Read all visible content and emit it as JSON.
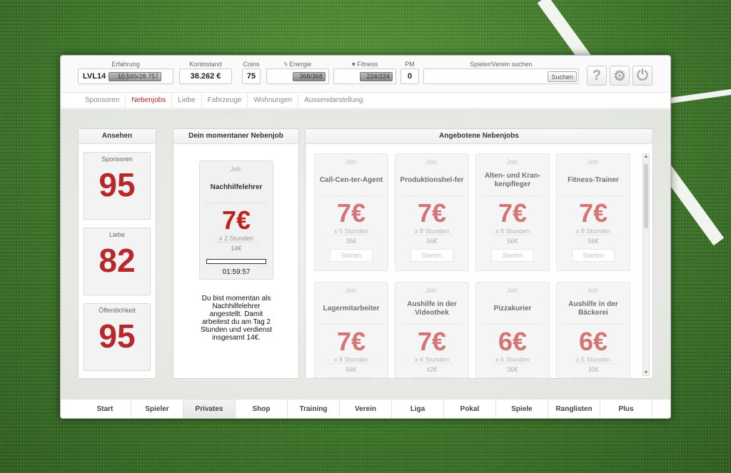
{
  "header": {
    "experience": {
      "label": "Erfahrung",
      "level": "LVL14",
      "value": "10.585/28.757",
      "progress": 0.37
    },
    "balance": {
      "label": "Kontostand",
      "value": "38.262 €"
    },
    "coins": {
      "label": "Coins",
      "value": "75"
    },
    "energy": {
      "label": "Energie",
      "value": "368/368",
      "progress": 1.0,
      "icon": "lightning-icon"
    },
    "fitness": {
      "label": "Fitness",
      "value": "224/224",
      "progress": 1.0,
      "icon": "heart-icon"
    },
    "pm": {
      "label": "PM",
      "value": "0"
    },
    "search": {
      "label": "Spieler/Verein suchen",
      "button": "Suchen",
      "value": ""
    },
    "icons": [
      "help-icon",
      "settings-icon",
      "power-icon"
    ]
  },
  "subtabs": [
    "Sponsoren",
    "Nebenjobs",
    "Liebe",
    "Fahrzeuge",
    "Wohnungen",
    "Aussendarstellung"
  ],
  "active_subtab": "Nebenjobs",
  "ansehen": {
    "title": "Ansehen",
    "items": [
      {
        "label": "Sponsoren",
        "value": "95"
      },
      {
        "label": "Liebe",
        "value": "82"
      },
      {
        "label": "Öffentlichkeit",
        "value": "95"
      }
    ]
  },
  "current_job": {
    "title": "Dein momentaner Nebenjob",
    "job_label": "Job:",
    "name": "Nachhilfelehrer",
    "pay": "7€",
    "duration": "x 2 Stunden",
    "total": "14€",
    "timer": "01:59:57",
    "description": "Du bist momentan als Nachhilfelehrer angestellt. Damit arbeitest du am Tag 2 Stunden und verdienst insgesamt 14€."
  },
  "offered_jobs": {
    "title": "Angebotene Nebenjobs",
    "job_label": "Job:",
    "start_label": "Starten",
    "jobs": [
      {
        "name": "Call-Cen-ter-Agent",
        "pay": "7€",
        "duration": "x 5 Stunden",
        "total": "35€"
      },
      {
        "name": "Produktionshel-fer",
        "pay": "7€",
        "duration": "x 8 Stunden",
        "total": "56€"
      },
      {
        "name": "Alten- und Kran-kenpfleger",
        "pay": "7€",
        "duration": "x 8 Stunden",
        "total": "56€"
      },
      {
        "name": "Fitness-Trainer",
        "pay": "7€",
        "duration": "x 8 Stunden",
        "total": "56€"
      },
      {
        "name": "Lagermitarbeiter",
        "pay": "7€",
        "duration": "x 8 Stunden",
        "total": "56€"
      },
      {
        "name": "Aushilfe in der Videothek",
        "pay": "7€",
        "duration": "x 6 Stunden",
        "total": "42€"
      },
      {
        "name": "Pizzakurier",
        "pay": "6€",
        "duration": "x 6 Stunden",
        "total": "36€"
      },
      {
        "name": "Aushilfe in der Bäckerei",
        "pay": "6€",
        "duration": "x 5 Stunden",
        "total": "30€"
      }
    ]
  },
  "bottom_nav": [
    "Start",
    "Spieler",
    "Privates",
    "Shop",
    "Training",
    "Verein",
    "Liga",
    "Pokal",
    "Spiele",
    "Ranglisten",
    "Plus"
  ],
  "active_nav": "Privates",
  "colors": {
    "accent": "#b72828",
    "pay": "#c23a3a"
  }
}
